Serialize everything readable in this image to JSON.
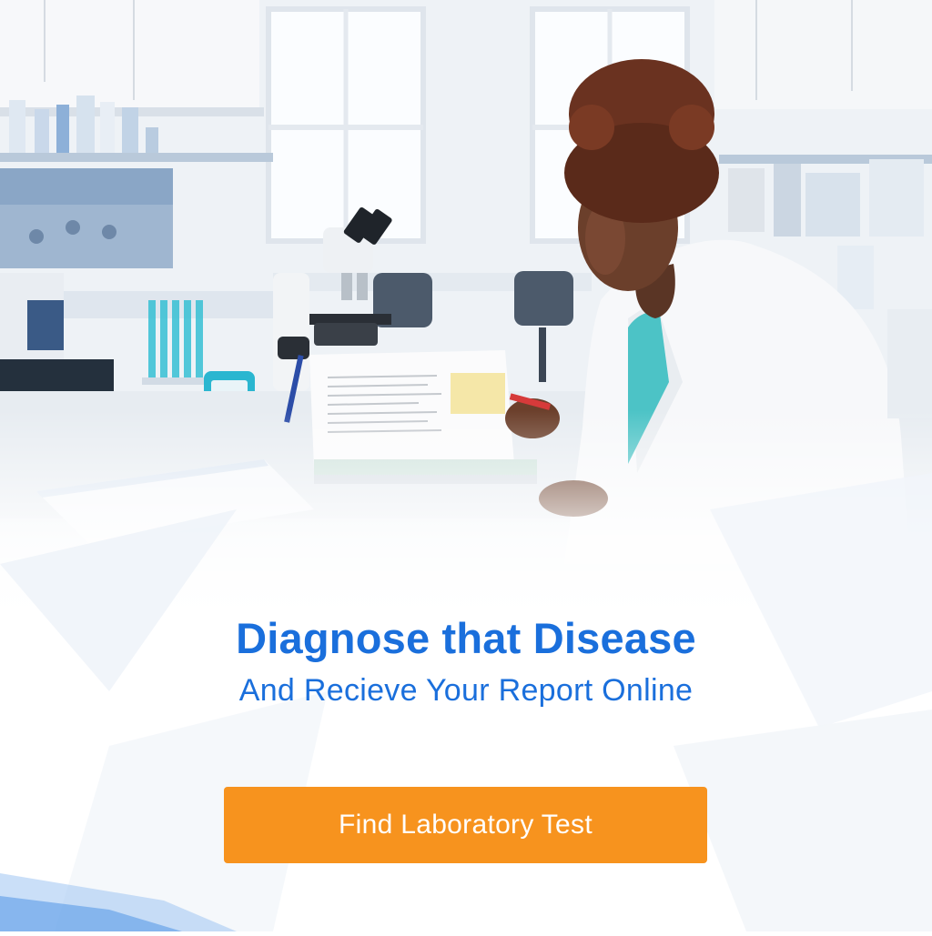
{
  "banner": {
    "headline": "Diagnose that Disease",
    "subheadline": "And Recieve Your Report Online",
    "cta_label": "Find Laboratory Test"
  },
  "colors": {
    "headline": "#1a6fdc",
    "subheadline": "#1a6fdc",
    "cta_background": "#f7931e",
    "cta_text": "#ffffff",
    "accent_blue": "#2f7fe0"
  }
}
